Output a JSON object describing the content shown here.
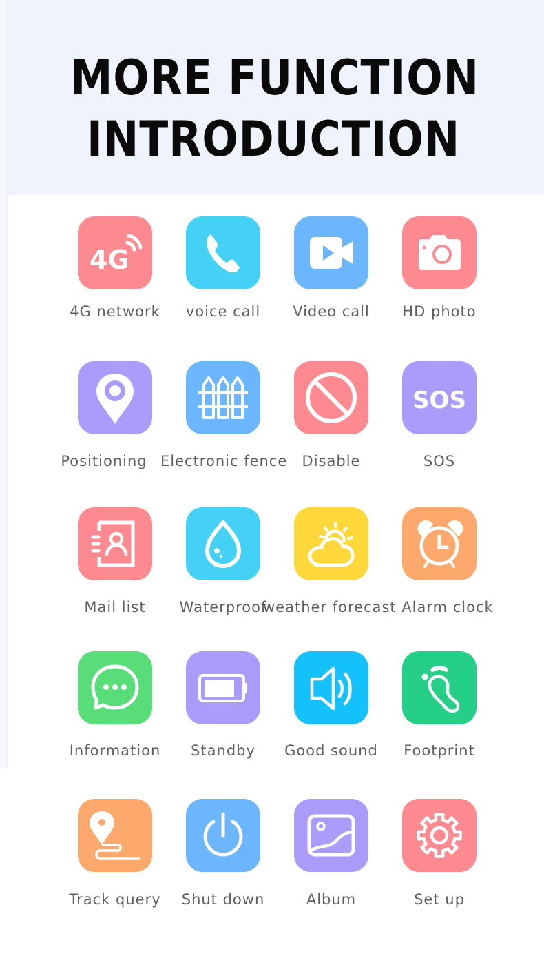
{
  "header": {
    "title_line1": "MORE FUNCTION",
    "title_line2": "INTRODUCTION"
  },
  "functions": [
    {
      "label": "4G network",
      "icon": "4g-signal-icon",
      "color": "#fd8a91"
    },
    {
      "label": "voice call",
      "icon": "phone-icon",
      "color": "#45d0f5"
    },
    {
      "label": "Video call",
      "icon": "video-camera-icon",
      "color": "#6cb6fd"
    },
    {
      "label": "HD photo",
      "icon": "camera-icon",
      "color": "#fd8a91"
    },
    {
      "label": "Positioning",
      "icon": "location-pin-icon",
      "color": "#ab9cfc"
    },
    {
      "label": "Electronic fence",
      "icon": "fence-icon",
      "color": "#6cb6fd"
    },
    {
      "label": "Disable",
      "icon": "prohibited-icon",
      "color": "#fd8a91"
    },
    {
      "label": "SOS",
      "icon": "sos-icon",
      "color": "#ab9cfc",
      "icon_text": "SOS"
    },
    {
      "label": "Mail list",
      "icon": "contacts-book-icon",
      "color": "#fd8a91"
    },
    {
      "label": "Waterproof",
      "icon": "water-drop-icon",
      "color": "#45d0f5"
    },
    {
      "label": "weather forecast",
      "icon": "sun-cloud-icon",
      "color": "#fed83b"
    },
    {
      "label": "Alarm clock",
      "icon": "alarm-clock-icon",
      "color": "#fda86c"
    },
    {
      "label": "Information",
      "icon": "chat-bubble-icon",
      "color": "#58dd79"
    },
    {
      "label": "Standby",
      "icon": "battery-icon",
      "color": "#ab9cfc"
    },
    {
      "label": "Good sound",
      "icon": "speaker-icon",
      "color": "#15c1fa"
    },
    {
      "label": "Footprint",
      "icon": "footprint-icon",
      "color": "#26cf88"
    },
    {
      "label": "Track query",
      "icon": "track-route-icon",
      "color": "#fda86c"
    },
    {
      "label": "Shut down",
      "icon": "power-icon",
      "color": "#6cb6fd"
    },
    {
      "label": "Album",
      "icon": "picture-icon",
      "color": "#ab9cfc"
    },
    {
      "label": "Set up",
      "icon": "gear-icon",
      "color": "#fd8a91"
    }
  ]
}
